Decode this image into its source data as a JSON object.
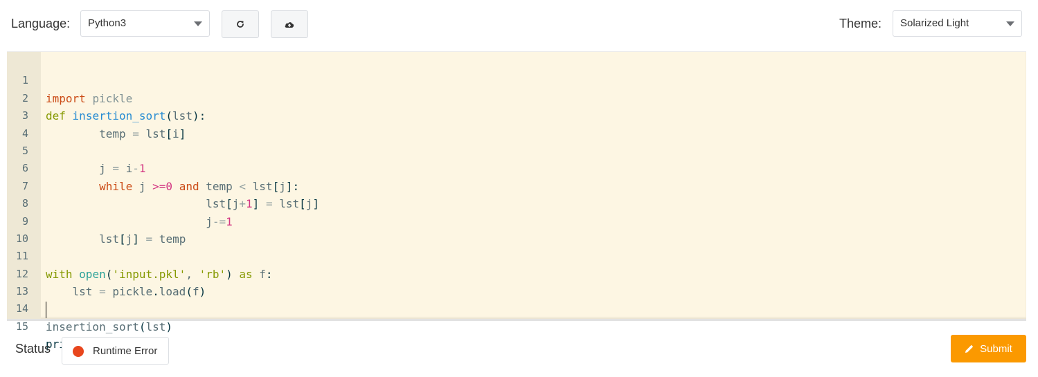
{
  "toolbar": {
    "language_label": "Language:",
    "language_value": "Python3",
    "theme_label": "Theme:",
    "theme_value": "Solarized Light",
    "reset_icon": "refresh-icon",
    "upload_icon": "cloud-upload-icon"
  },
  "editor": {
    "line_numbers": [
      "1",
      "2",
      "3",
      "4",
      "5",
      "6",
      "7",
      "8",
      "9",
      "10",
      "11",
      "12",
      "13",
      "14",
      "15"
    ],
    "lines": [
      "import pickle",
      "def insertion_sort(lst):",
      "        temp = lst[i]",
      "",
      "        j = i-1",
      "        while j >=0 and temp < lst[j]:",
      "                        lst[j+1] = lst[j]",
      "                        j-=1",
      "        lst[j] = temp",
      "",
      "with open('input.pkl', 'rb') as f:",
      "    lst = pickle.load(f)",
      "",
      "insertion_sort(lst)",
      "print(lst)"
    ],
    "cursor_line": 13
  },
  "status": {
    "label": "Status",
    "value": "Runtime Error",
    "color": "#e8461d"
  },
  "submit": {
    "label": "Submit",
    "icon": "pencil-icon",
    "color": "#fb9900"
  },
  "colors": {
    "editor_bg": "#fdf6e3",
    "gutter_bg": "#eee8d5"
  }
}
